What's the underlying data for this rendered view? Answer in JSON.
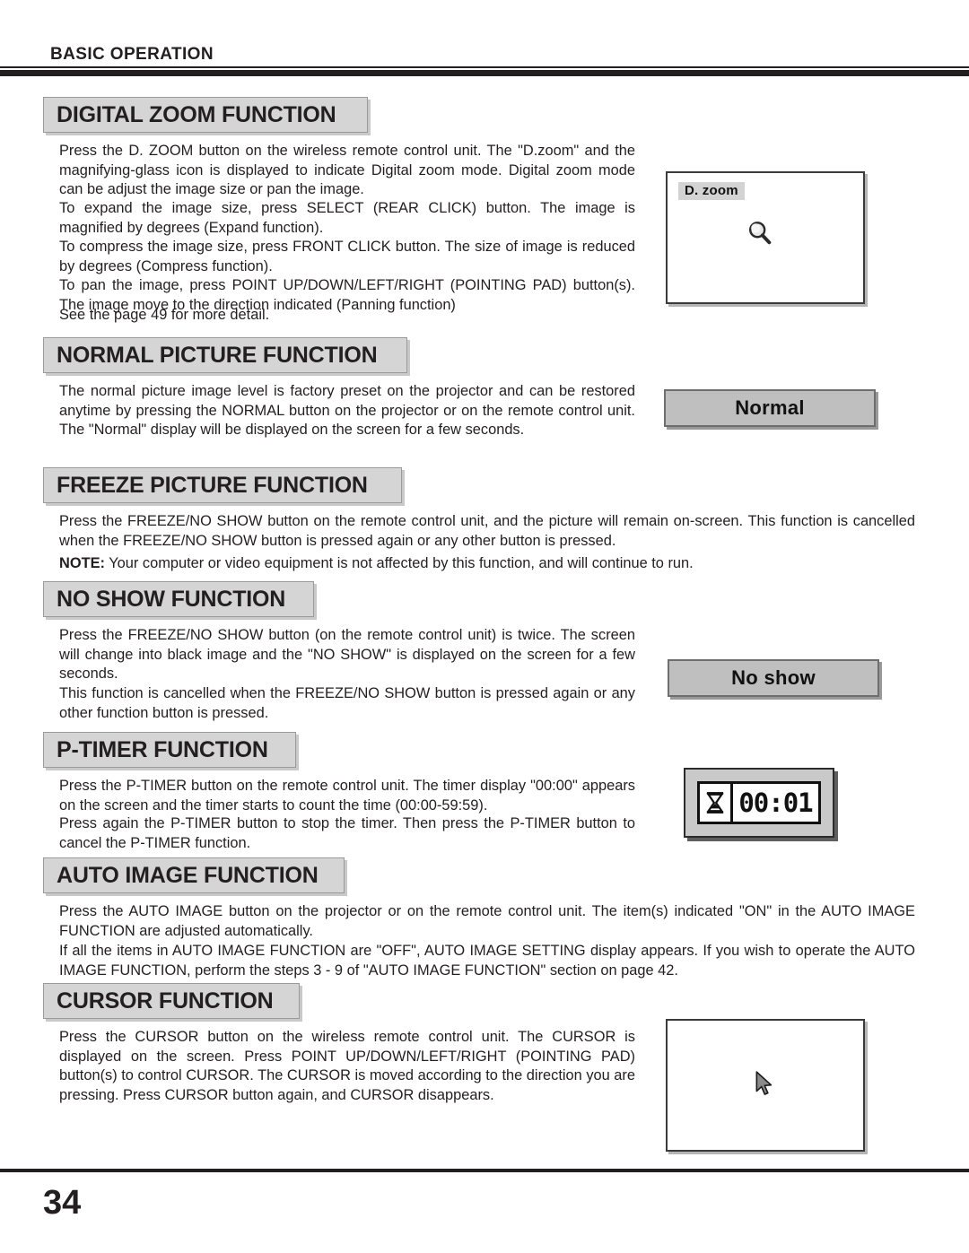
{
  "header": {
    "title": "BASIC OPERATION"
  },
  "footer": {
    "page_number": "34"
  },
  "sections": [
    {
      "heading": "DIGITAL ZOOM FUNCTION",
      "paragraphs": [
        "Press the D. ZOOM button on the wireless remote control unit. The \"D.zoom\" and the magnifying-glass icon is displayed to indicate Digital zoom mode. Digital zoom mode can be adjust the image size or pan the image.",
        "To expand the image size, press SELECT (REAR CLICK) button. The image is magnified by degrees (Expand function).",
        "To compress the image size, press FRONT CLICK button. The size of image is reduced by degrees (Compress function).",
        "To pan the image, press POINT UP/DOWN/LEFT/RIGHT (POINTING PAD) button(s). The image move to the direction indicated (Panning function)",
        "See the page 49 for more detail."
      ]
    },
    {
      "heading": "NORMAL PICTURE FUNCTION",
      "paragraphs": [
        "The normal picture image level is factory preset on the projector and can be restored anytime by pressing the NORMAL button on the projector or on the remote control unit. The \"Normal\" display will be displayed on the screen for a few seconds."
      ]
    },
    {
      "heading": "FREEZE PICTURE FUNCTION",
      "paragraphs": [
        "Press the FREEZE/NO SHOW button on the remote control unit, and the picture will remain on-screen. This function is cancelled when the FREEZE/NO SHOW button is pressed again or  any other button is pressed."
      ],
      "note_label": "NOTE:",
      "note_text": " Your computer or video equipment is not affected by this function, and will continue to run."
    },
    {
      "heading": "NO SHOW FUNCTION",
      "paragraphs": [
        "Press the FREEZE/NO SHOW button (on the remote control unit) is twice. The screen will change into black image and the \"NO SHOW\" is displayed on the screen for a few seconds.",
        "This function is cancelled when the FREEZE/NO SHOW button is pressed again or any other function button is pressed."
      ]
    },
    {
      "heading": "P-TIMER FUNCTION",
      "paragraphs": [
        "Press the P-TIMER button on the remote control unit. The timer display \"00:00\" appears on the screen and the timer starts to count the time (00:00-59:59).",
        "Press again the P-TIMER button to stop the timer. Then press the P-TIMER button to cancel the P-TIMER function."
      ]
    },
    {
      "heading": "AUTO IMAGE FUNCTION",
      "paragraphs": [
        "Press  the AUTO IMAGE button on the projector or on the remote control unit. The item(s) indicated \"ON\" in the AUTO IMAGE FUNCTION are adjusted automatically.",
        "If all the items in AUTO IMAGE FUNCTION are \"OFF\", AUTO IMAGE SETTING display appears. If you wish to operate the AUTO IMAGE FUNCTION, perform the steps 3 - 9 of \"AUTO IMAGE FUNCTION\" section on page 42."
      ]
    },
    {
      "heading": "CURSOR FUNCTION",
      "paragraphs": [
        "Press the CURSOR button on the wireless remote control unit. The CURSOR is displayed on the screen. Press POINT UP/DOWN/LEFT/RIGHT (POINTING PAD) button(s) to control CURSOR. The CURSOR is moved according to the direction you are pressing. Press CURSOR button again, and CURSOR disappears."
      ]
    }
  ],
  "illustrations": {
    "dzoom_screen": {
      "osd_label": "D. zoom",
      "icon": "magnifier-icon"
    },
    "normal_osd": {
      "text": "Normal"
    },
    "noshow_osd": {
      "text": "No show"
    },
    "ptimer_osd": {
      "icon": "hourglass-icon",
      "time": "00:01"
    },
    "cursor_screen": {
      "icon": "cursor-arrow-icon"
    }
  },
  "colors": {
    "ink": "#231f20",
    "heading_fill": "#d5d5d5",
    "osd_fill": "#bfbfbf",
    "timer_fill": "#c9c9c9"
  }
}
